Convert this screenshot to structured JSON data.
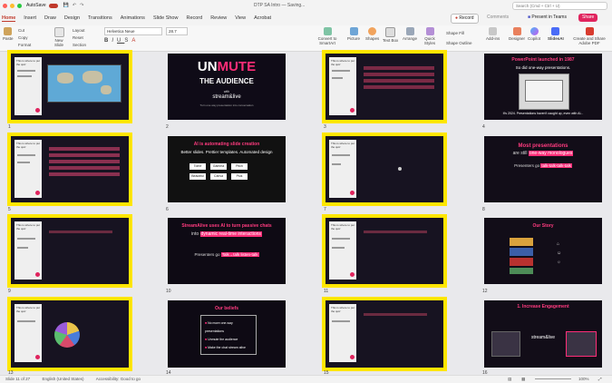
{
  "titlebar": {
    "autosave": "AutoSave",
    "doc_title": "DTP SA Intro — Saving...",
    "search_placeholder": "Search (Cmd + Ctrl + U)"
  },
  "tabs": [
    "Home",
    "Insert",
    "Draw",
    "Design",
    "Transitions",
    "Animations",
    "Slide Show",
    "Record",
    "Review",
    "View",
    "Acrobat"
  ],
  "ribbon_right": {
    "record": "Record",
    "comments": "Comments",
    "present_teams": "Present in Teams",
    "share": "Share"
  },
  "ribbon": {
    "paste": "Paste",
    "cut": "Cut",
    "copy": "Copy",
    "format": "Format",
    "new_slide": "New Slide",
    "layout": "Layout",
    "reset": "Reset",
    "section": "Section",
    "font_name": "Helvetica Neue",
    "font_size": "28.7",
    "convert_smartart": "Convert to SmartArt",
    "picture": "Picture",
    "shapes": "Shapes",
    "text_box": "Text Box",
    "arrange": "Arrange",
    "quick_styles": "Quick Styles",
    "shape_fill": "Shape Fill",
    "shape_outline": "Shape Outline",
    "add_ins": "Add-ins",
    "designer": "Designer",
    "copilot": "Copilot",
    "slidesai": "SlidesAI",
    "create_pdf": "Create and Share Adobe PDF"
  },
  "slides": {
    "s2": {
      "un": "UN",
      "mute": "MUTE",
      "the_audience": "THE AUDIENCE",
      "with": "with",
      "brand": "stream&live",
      "sub": "Turn one way presentation into conversation"
    },
    "s4": {
      "title": "PowerPoint launched in 1987",
      "sub": "So did one-way presentations.",
      "foot": "It's 2024. Presentations haven't caught up, even with AI..."
    },
    "s6": {
      "title": "AI is automating slide creation",
      "sub": "Better slides. Prettier templates. Automated design",
      "tools": [
        "Tome",
        "Gamma",
        "Pitch",
        "Beautiful",
        "Canva",
        "Plus"
      ]
    },
    "s8": {
      "title": "Most presentations",
      "line2_pre": "are still",
      "line2_hl": "one-way monologues",
      "line3_pre": "Presenters go",
      "line3_hl": "talk-talk-talk-talk"
    },
    "s10": {
      "title": "StreamAlive uses AI to turn passive chats",
      "line2_pre": "into",
      "line2_hl": "dynamic real-time interactions",
      "line3_pre": "Presenters go",
      "line3_hl": "Talk→talk listen-talk"
    },
    "s12": {
      "title": "Our Story"
    },
    "s14": {
      "title": "Our beliefs",
      "items": [
        "No more one-way presentations",
        "Unmute the audience",
        "Make the chat stream alive"
      ]
    },
    "s16": {
      "title": "1. Increase Engagement",
      "brand": "stream&live"
    },
    "panel_title": "This is where to put the quiz"
  },
  "slide_numbers": [
    "1",
    "2",
    "3",
    "4",
    "5",
    "6",
    "7",
    "8",
    "9",
    "10",
    "11",
    "12",
    "13",
    "14",
    "15",
    "16"
  ],
  "status": {
    "slide_of": "Slide 11 of 27",
    "language": "English (United States)",
    "accessibility": "Accessibility: Good to go",
    "zoom": "100%"
  },
  "colors": {
    "accent": "#c0392b",
    "selection": "#ffe600",
    "slide_bg": "#171321",
    "pink": "#ff2d78"
  }
}
